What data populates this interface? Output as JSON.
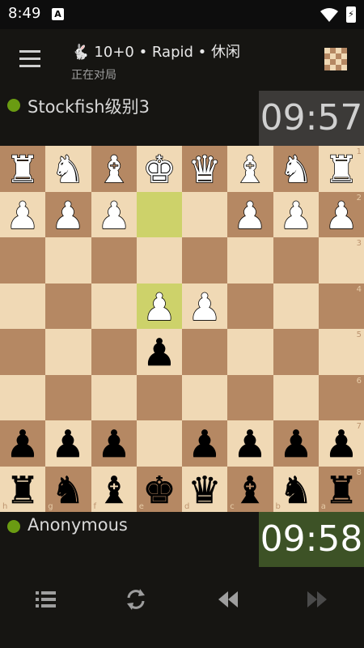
{
  "status_bar": {
    "time": "8:49",
    "notification_icon": "A"
  },
  "header": {
    "speed_icon": "rabbit-icon",
    "game_info": "10+0 • Rapid • 休闲",
    "status": "正在对局"
  },
  "opponent": {
    "name": "Stockfish级别3",
    "clock": "09:57",
    "online": true
  },
  "player": {
    "name": "Anonymous",
    "clock": "09:58",
    "online": true
  },
  "board": {
    "orientation": "black",
    "light_color": "#f0d9b5",
    "dark_color": "#b58863",
    "highlight_color": "#cdd26a",
    "last_move": [
      "e2",
      "e4"
    ],
    "position_fen": "rnbqkbnr/pppp1ppp/8/4p3/3PP3/8/PPP2PPP/RNBQKBNR",
    "rank_labels": [
      "1",
      "2",
      "3",
      "4",
      "5",
      "6",
      "7",
      "8"
    ],
    "file_labels": [
      "h",
      "g",
      "f",
      "e",
      "d",
      "c",
      "b",
      "a"
    ]
  },
  "toolbar": {
    "buttons": [
      "moves-list-icon",
      "flip-board-icon",
      "previous-move-icon",
      "next-move-icon"
    ]
  }
}
